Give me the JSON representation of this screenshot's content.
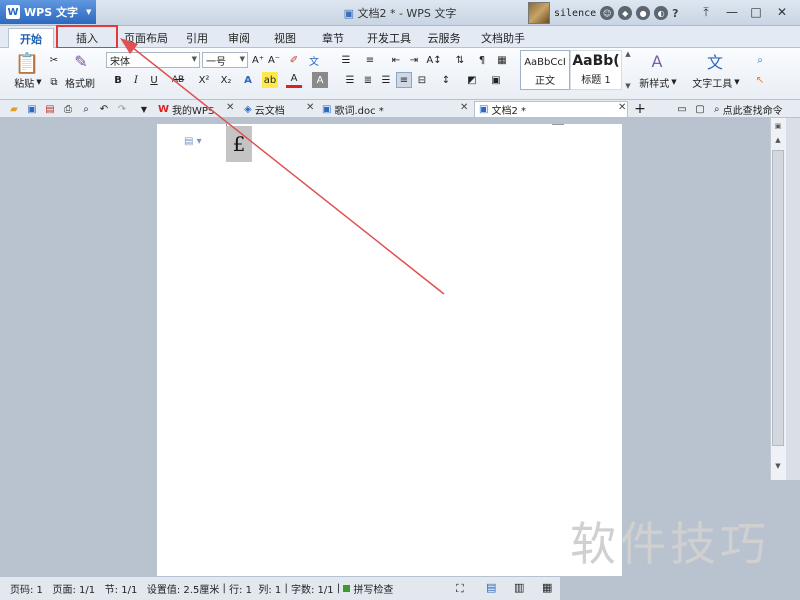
{
  "titlebar": {
    "app_button": "WPS 文字",
    "app_logo": "W",
    "window_title": "文档2 * - WPS 文字",
    "username": "silence",
    "help": "?",
    "minimize": "—",
    "maximize": "□",
    "close": "✕"
  },
  "ribbon_tabs": [
    "开始",
    "插入",
    "页面布局",
    "引用",
    "审阅",
    "视图",
    "章节",
    "开发工具",
    "云服务",
    "文档助手"
  ],
  "toolbar": {
    "paste": "粘贴",
    "format_painter": "格式刷",
    "font_name": "宋体",
    "font_size": "一号",
    "bold": "B",
    "italic": "I",
    "underline": "U",
    "strike": "AB",
    "superscript": "X²",
    "subscript": "X₂",
    "style_normal_sample": "AaBbCcI",
    "style_normal_label": "正文",
    "style_heading_sample": "AaBb(",
    "style_heading_label": "标题 1",
    "new_style": "新样式",
    "text_tools": "文字工具"
  },
  "doc_tabs": [
    {
      "label": "我的WPS"
    },
    {
      "label": "云文档"
    },
    {
      "label": "歌词.doc *"
    },
    {
      "label": "文档2 *"
    }
  ],
  "search_command": "点此查找命令",
  "document": {
    "cursor_char": "£"
  },
  "statusbar": {
    "page": "页码: 1",
    "pages": "页面: 1/1",
    "section": "节: 1/1",
    "setting": "设置值: 2.5厘米",
    "row": "行: 1",
    "col": "列: 1",
    "chars": "字数: 1/1",
    "spell": "拼写检查"
  },
  "watermark": "软件技巧",
  "colors": {
    "highlight": "#e03a3a",
    "arrow": "#e05050",
    "app_blue": "#2c68be"
  }
}
